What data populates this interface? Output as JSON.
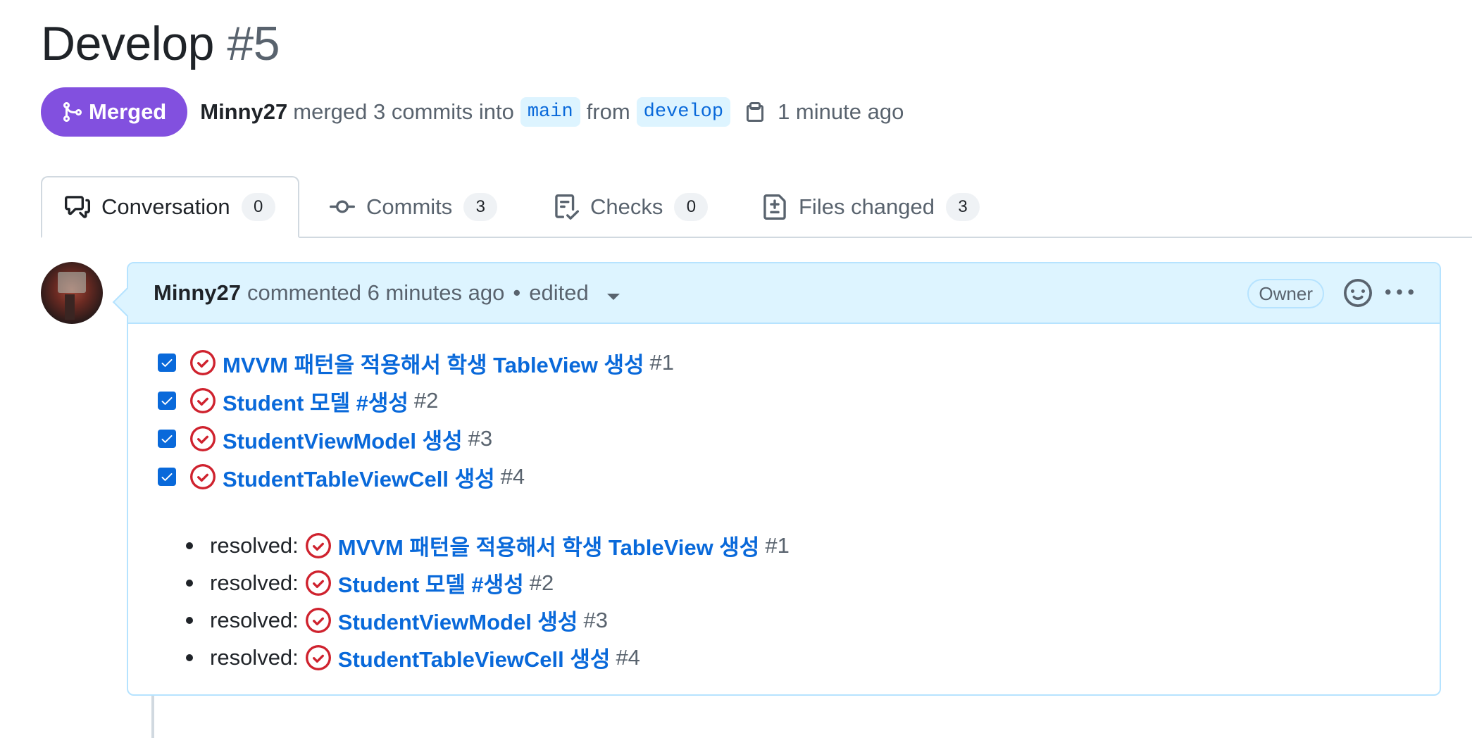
{
  "pr": {
    "title": "Develop",
    "number": "#5",
    "status_label": "Merged",
    "author": "Minny27",
    "merge_text": "merged 3 commits into",
    "base_branch": "main",
    "from_text": "from",
    "head_branch": "develop",
    "time_ago": "1 minute ago"
  },
  "tabs": [
    {
      "label": "Conversation",
      "count": "0",
      "icon": "comment-discussion-icon",
      "active": true
    },
    {
      "label": "Commits",
      "count": "3",
      "icon": "git-commit-icon",
      "active": false
    },
    {
      "label": "Checks",
      "count": "0",
      "icon": "checklist-icon",
      "active": false
    },
    {
      "label": "Files changed",
      "count": "3",
      "icon": "file-diff-icon",
      "active": false
    }
  ],
  "comment": {
    "author": "Minny27",
    "action": "commented",
    "time_ago": "6 minutes ago",
    "separator": "•",
    "edited": "edited",
    "role_badge": "Owner",
    "tasks": [
      {
        "title": "MVVM 패턴을 적용해서 학생 TableView 생성",
        "ref": "#1",
        "checked": true
      },
      {
        "title": "Student 모델 #생성",
        "ref": "#2",
        "checked": true
      },
      {
        "title": "StudentViewModel 생성",
        "ref": "#3",
        "checked": true
      },
      {
        "title": "StudentTableViewCell 생성",
        "ref": "#4",
        "checked": true
      }
    ],
    "resolved_label": "resolved:",
    "resolved": [
      {
        "title": "MVVM 패턴을 적용해서 학생 TableView 생성",
        "ref": "#1"
      },
      {
        "title": "Student 모델 #생성",
        "ref": "#2"
      },
      {
        "title": "StudentViewModel 생성",
        "ref": "#3"
      },
      {
        "title": "StudentTableViewCell 생성",
        "ref": "#4"
      }
    ]
  },
  "colors": {
    "merged": "#8250df",
    "link": "#0969da",
    "closed_issue": "#cf222e",
    "comment_header_bg": "#ddf4ff",
    "muted_text": "#59636e"
  }
}
